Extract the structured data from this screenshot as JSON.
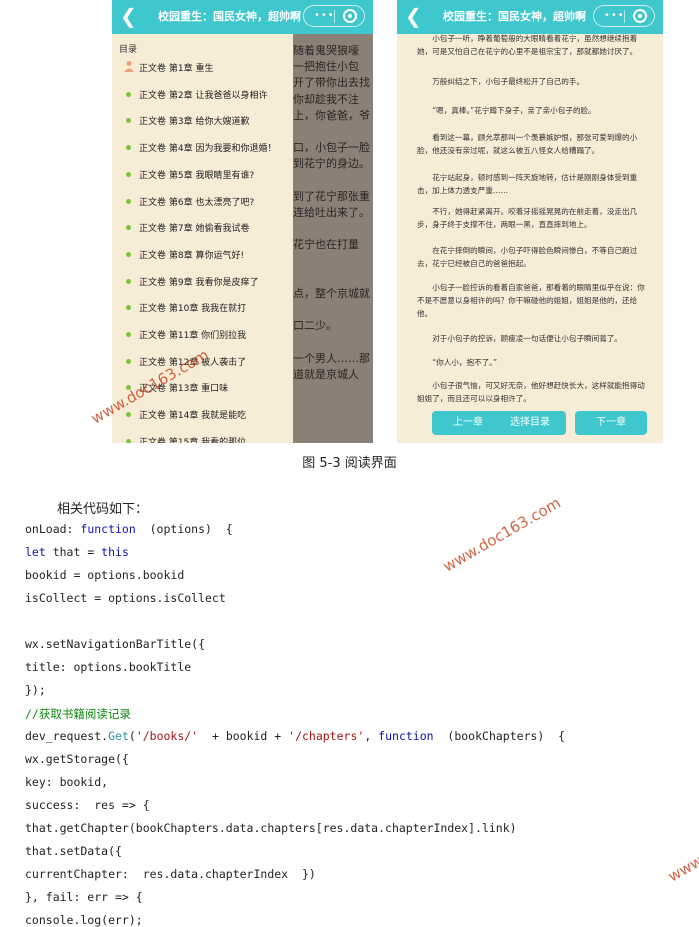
{
  "left_phone": {
    "nav_title": "校园重生：国民女神，超帅啊",
    "toc_heading": "目录",
    "chapters": [
      "正文卷 第1章 重生",
      "正文卷 第2章 让我爸爸以身相许",
      "正文卷 第3章 给你大嫂道歉",
      "正文卷 第4章 因为我要和你退婚！",
      "正文卷 第5章 我眼睛里有谁?",
      "正文卷 第6章 也太漂亮了吧?",
      "正文卷 第7章 她偷看我试卷",
      "正文卷 第8章 算你运气好!",
      "正文卷 第9章 我看你是皮痒了",
      "正文卷 第10章 我我在就打",
      "正文卷 第11章 你们别拉我",
      "正文卷 第12章 被人袭击了",
      "正文卷 第13章 重口味",
      "正文卷 第14章 我就是能吃",
      "正文卷 第15章 我看的那位"
    ],
    "background_lines": [
      "随着鬼哭狼嚎",
      "一把抱住小包",
      "开了带你出去找",
      "你却趁我不注",
      "上，你爸爸，爷",
      "",
      "口，小包子一脸",
      "到花宁的身边。",
      "",
      "到了花宁那张重",
      "连给吐出来了。",
      "",
      "花宁也在打量",
      "",
      "",
      "点，整个京城就",
      "",
      "口二少。",
      "",
      "一个男人……那",
      "道就是京城人"
    ]
  },
  "right_phone": {
    "nav_title": "校园重生：国民女神，超帅啊",
    "paragraphs": [
      "小包子一听，睁着葡萄般的大眼睛看着花宁，虽然想继续抱着她，可是又怕自己在花宁的心里不是祖宗宝了，那就都她讨厌了。",
      "万般纠结之下，小包子最终松开了自己的手。",
      "“嗯，真棒。”花宁蹲下身子，亲了亲小包子的脸。",
      "看到这一幕，顾允萃那叫一个羡慕嫉妒恨，那张可爱到爆的小脸，他还没有亲过呢，就这么被五八怪女人给糟蹋了。",
      "花宁站起身，顿时感到一阵天旋地转，估计是刚刚身体受到重击，加上体力透支严重……",
      "不行，她得赶紧离开。咬着牙摇摇晃晃的在前走着，没走出几步，身子终于支撑不住，两眼一黑，直直摔到地上。",
      "在花宁摔倒的瞬间，小包子吓得脸色瞬间惨白，不等自己跑过去，花宁已经被自己的爸爸抱起。",
      "小包子一脸控诉的看着自家爸爸，那看着的眼睛里似乎在说：你不是不愿意以身相许的吗？你干嘛碰他的姐姐，姐姐是他的，还给他。",
      "对于小包子的控诉，顾瘦凌一句话便让小包子瞬间蔫了。",
      "“你人小，抱不了。”",
      "小包子很气恼，可又好无奈，他好想赶快长大，这样就能抱得动姐姐了，而且还可以以身相许了。"
    ],
    "buttons": {
      "prev": "上一章",
      "toc": "选择目录",
      "next": "下一章"
    }
  },
  "caption": "图 5-3  阅读界面",
  "intro": "相关代码如下：",
  "watermark": "www.doc163.com",
  "colors": {
    "accent": "#3ec7cc",
    "page_bg": "#f7ecd6",
    "bullet": "#7cc242",
    "watermark": "#c8401a"
  }
}
